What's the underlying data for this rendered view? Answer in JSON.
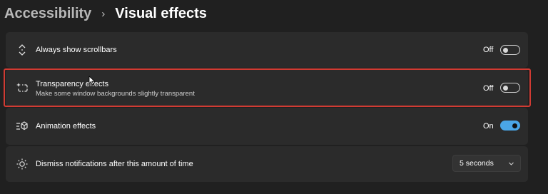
{
  "breadcrumb": {
    "parent": "Accessibility",
    "separator": "›",
    "current": "Visual effects"
  },
  "settings": [
    {
      "label": "Always show scrollbars",
      "state": "Off",
      "icon": "scrollbar-arrows-icon"
    },
    {
      "label": "Transparency effects",
      "description": "Make some window backgrounds slightly transparent",
      "state": "Off",
      "icon": "transparency-sparkle-icon",
      "highlighted": true
    },
    {
      "label": "Animation effects",
      "state": "On",
      "icon": "animation-icon"
    },
    {
      "label": "Dismiss notifications after this amount of time",
      "dropdown_value": "5 seconds",
      "icon": "brightness-icon"
    }
  ],
  "colors": {
    "background": "#202020",
    "card": "#2b2b2b",
    "accent": "#4aa6e6",
    "highlight_border": "#d13b33"
  }
}
